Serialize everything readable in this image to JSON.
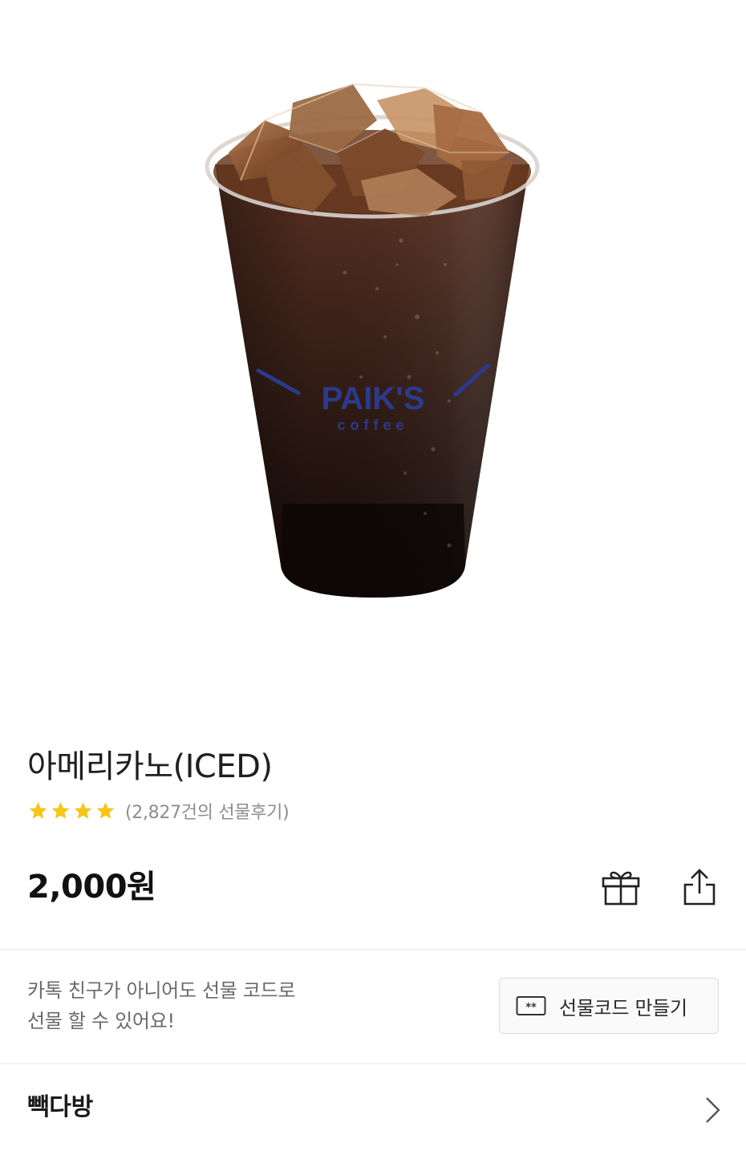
{
  "product": {
    "image_icon": "iced-americano-cup-image",
    "cup_logo_text": "PAIK'S",
    "cup_logo_subtext": "coffee",
    "title": "아메리카노(ICED)",
    "rating_stars": 4,
    "rating_max": 4,
    "review_count": "(2,827건의 선물후기)",
    "price": "2,000원"
  },
  "actions": {
    "gift_icon": "gift-icon",
    "share_icon": "share-icon"
  },
  "gift_code": {
    "info_line1": "카톡 친구가 아니어도 선물 코드로",
    "info_line2": "선물 할 수 있어요!",
    "button_label": "선물코드 만들기",
    "button_icon": "gift-code-ticket-icon"
  },
  "brand": {
    "name": "빽다방",
    "chevron_icon": "chevron-right-icon"
  },
  "colors": {
    "star": "#f5c518",
    "logo_blue": "#2b3a8c",
    "divider": "#f2f2f2"
  }
}
